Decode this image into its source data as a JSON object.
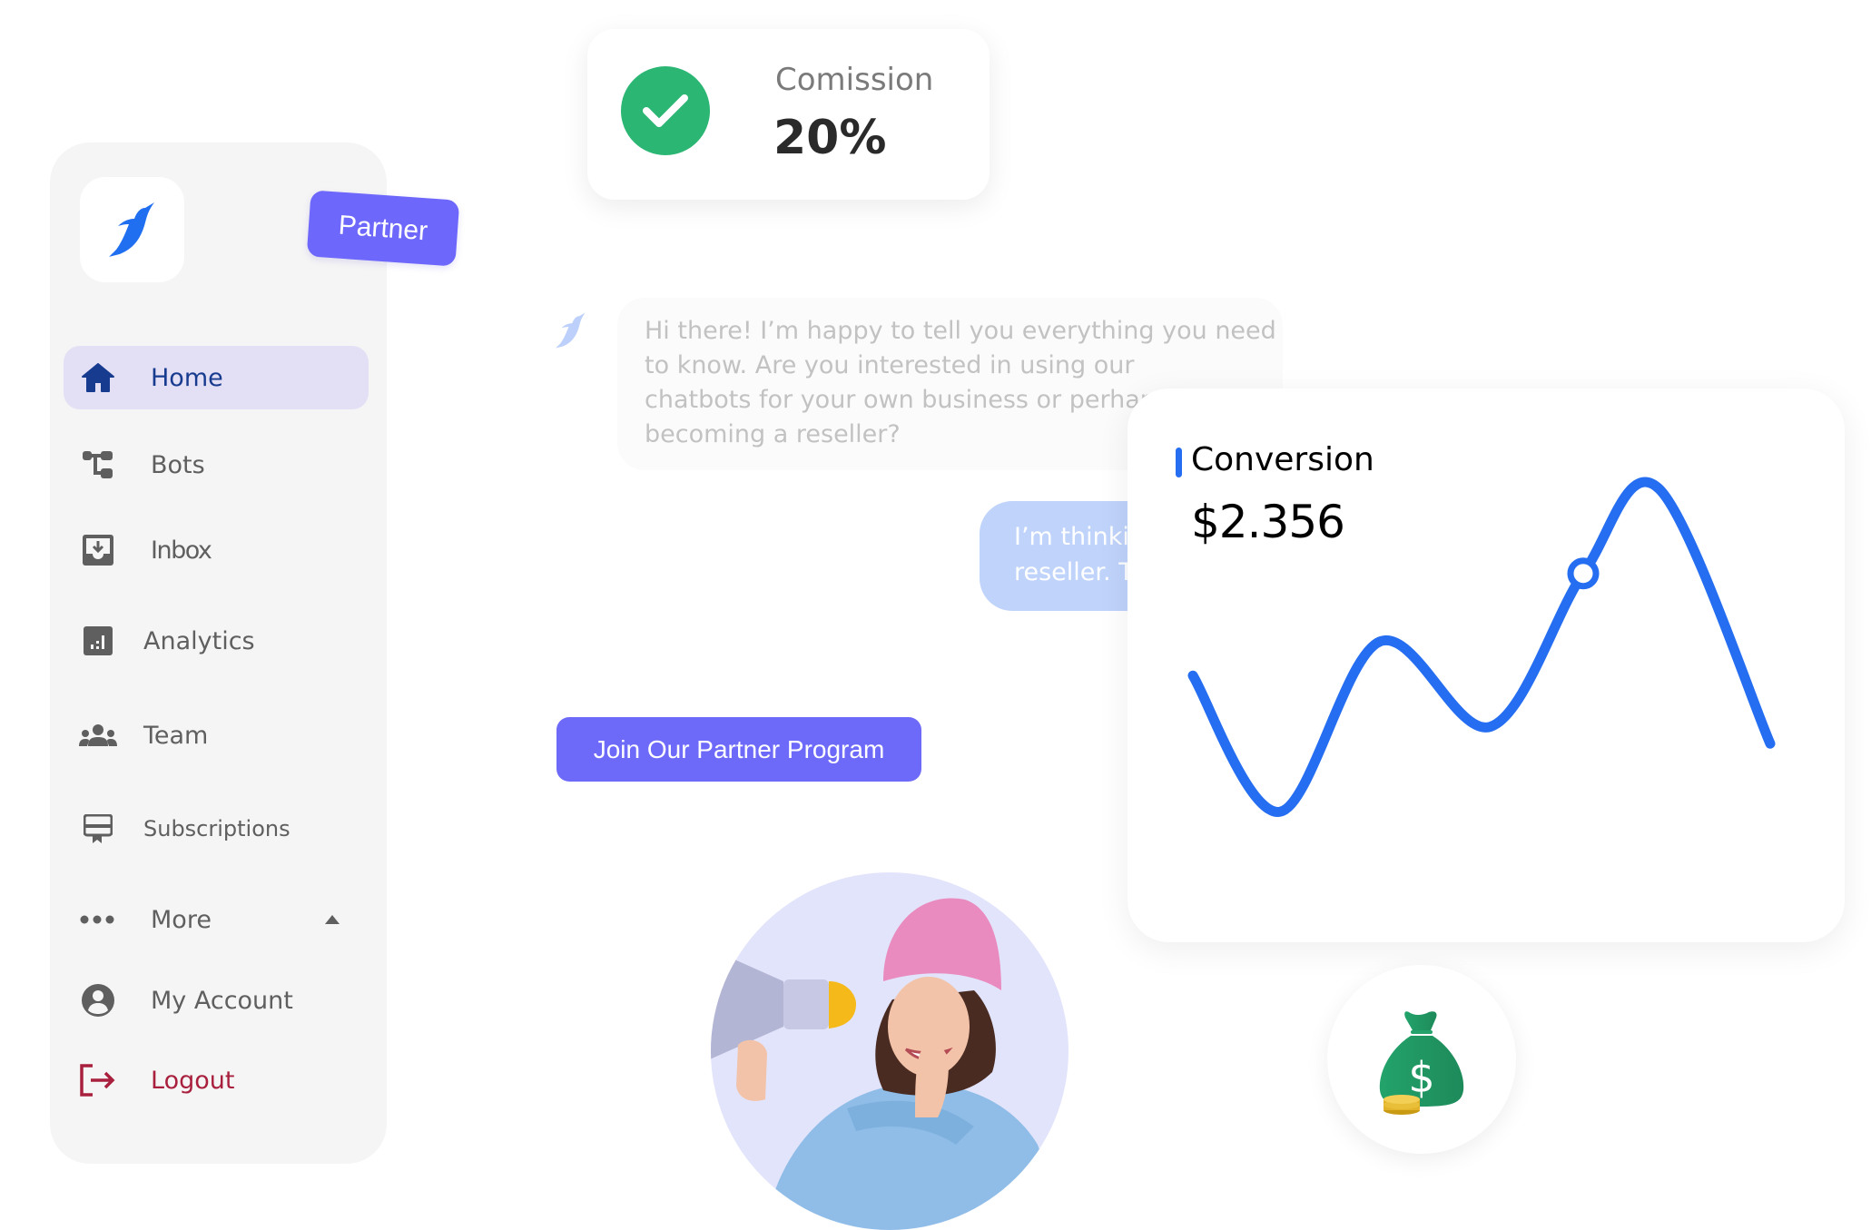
{
  "sidebar": {
    "logo": "penguin-logo",
    "items": [
      {
        "label": "Home",
        "icon": "home-icon",
        "active": true
      },
      {
        "label": "Bots",
        "icon": "bots-flow-icon"
      },
      {
        "label": "Inbox",
        "icon": "inbox-icon"
      },
      {
        "label": "Analytics",
        "icon": "analytics-icon"
      },
      {
        "label": "Team",
        "icon": "team-icon"
      },
      {
        "label": "Subscriptions",
        "icon": "subscriptions-icon"
      },
      {
        "label": "More",
        "icon": "more-dots-icon",
        "expanded": true
      },
      {
        "label": "My Account",
        "icon": "account-icon"
      },
      {
        "label": "Logout",
        "icon": "logout-icon"
      }
    ]
  },
  "partner_tag": {
    "label": "Partner"
  },
  "commission": {
    "label": "Comission",
    "value": "20%",
    "icon": "check-circle-icon"
  },
  "chat": {
    "bot_message": "Hi there! I’m happy to tell you everything you need\nto know.  Are you interested in using our\nchatbots for your own business or perhaps\nbecoming a reseller?",
    "user_message": "I’m thinking about becoming a\nreseller. T"
  },
  "cta": {
    "label": "Join Our Partner Program"
  },
  "conversion": {
    "label": "Conversion",
    "value": "$2.356"
  },
  "chart_data": {
    "type": "line",
    "title": "Conversion",
    "xlabel": "",
    "ylabel": "",
    "x": [
      0,
      1,
      2,
      3,
      4,
      5,
      6
    ],
    "series": [
      {
        "name": "Conversion",
        "values": [
          0.45,
          0.05,
          0.55,
          0.3,
          0.75,
          1.0,
          0.25
        ]
      }
    ],
    "highlight_index": 4,
    "grid": false,
    "axes_visible": false,
    "ylim": [
      0,
      1
    ]
  },
  "colors": {
    "accent": "#266ef1",
    "cta": "#6e6af9",
    "success": "#2bb673",
    "danger": "#a8203d",
    "active_nav_bg": "#e3dff5",
    "active_nav_text": "#173b8f"
  },
  "images": {
    "hero": "woman-with-megaphone",
    "money": "money-bag-with-coins"
  }
}
